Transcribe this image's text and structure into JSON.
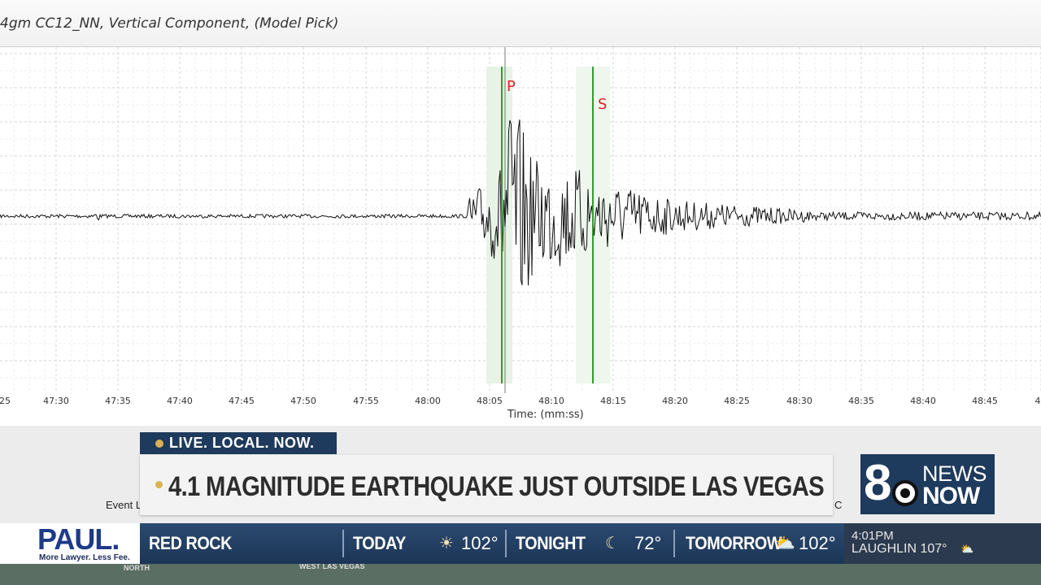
{
  "window": {
    "title": "4gm CC12_NN, Vertical Component, (Model Pick)"
  },
  "seismogram": {
    "p_label": "P",
    "s_label": "S",
    "xlabel": "Time: (mm:ss)",
    "tick_labels": [
      "25",
      "47:30",
      "47:35",
      "47:40",
      "47:45",
      "47:50",
      "47:55",
      "48:00",
      "48:05",
      "48:10",
      "48:15",
      "48:20",
      "48:25",
      "48:30",
      "48:35",
      "48:40",
      "48:45",
      "4"
    ],
    "trace_color": "#111111",
    "pick_line_color": "#2ca02c",
    "pick_label_color": "#e0202a",
    "lower_labels": {
      "event": "Event L",
      "right": "C"
    }
  },
  "broadcast": {
    "live_tag": "LIVE. LOCAL. NOW.",
    "headline": "4.1 MAGNITUDE EARTHQUAKE JUST OUTSIDE LAS VEGAS",
    "logo": {
      "number": "8",
      "top": "NEWS",
      "bottom": "NOW"
    },
    "sponsor": {
      "name": "PAUL.",
      "tagline": "More Lawyer. Less Fee."
    },
    "weather": {
      "location": "RED ROCK",
      "today_label": "TODAY",
      "today_temp": "102°",
      "today_icon": "sun-icon",
      "tonight_label": "TONIGHT",
      "tonight_temp": "72°",
      "tonight_icon": "moon-icon",
      "tomorrow_label": "TOMORROW",
      "tomorrow_temp": "102°",
      "tomorrow_icon": "partly-cloudy-icon"
    },
    "clock": "4:01PM",
    "ticker_city": "LAUGHLIN 107°",
    "map_labels": [
      "NORTH",
      "WEST LAS VEGAS"
    ],
    "colors": {
      "navy": "#1e3a5c",
      "gold": "#d8b254"
    }
  }
}
